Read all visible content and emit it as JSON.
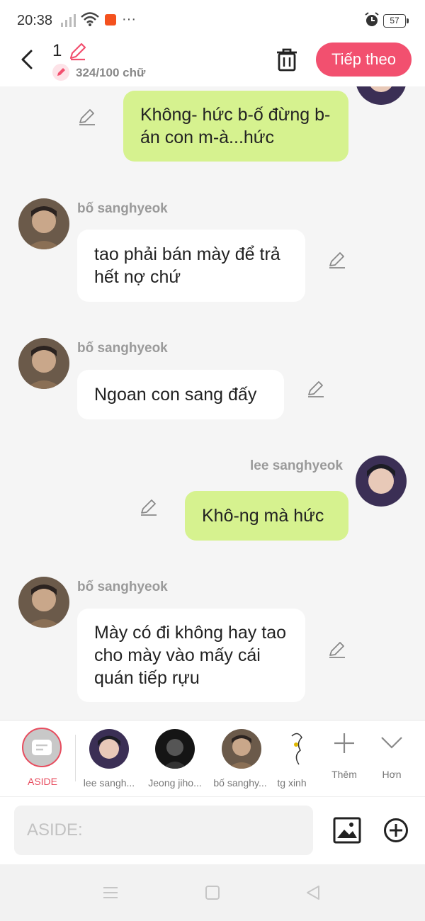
{
  "status_bar": {
    "time": "20:38",
    "battery": "57"
  },
  "header": {
    "episode_number": "1",
    "word_count": "324/100 chữ",
    "next_label": "Tiếp theo"
  },
  "messages": [
    {
      "side": "right",
      "text": "Không- hức b-ố đừng b-án con m-à...hức"
    },
    {
      "side": "left",
      "name": "bố sanghyeok",
      "text": "tao phải bán mày để trả hết nợ chứ"
    },
    {
      "side": "left",
      "name": "bố sanghyeok",
      "text": "Ngoan con sang đấy"
    },
    {
      "side": "right",
      "name": "lee sanghyeok",
      "text": "Khô-ng mà hức"
    },
    {
      "side": "left",
      "name": "bố sanghyeok",
      "text": "Mày có đi không hay tao cho mày vào mấy cái quán tiếp rựu"
    }
  ],
  "characters": {
    "aside_label": "ASIDE",
    "items": [
      {
        "label": "lee sangh..."
      },
      {
        "label": "Jeong jiho..."
      },
      {
        "label": "bố sanghy..."
      },
      {
        "label": "tg xinh"
      }
    ],
    "add_label": "Thêm",
    "more_label": "Hơn"
  },
  "input": {
    "placeholder": "ASIDE:"
  },
  "colors": {
    "accent": "#f2506f",
    "bubble_right": "#d6f28f",
    "bubble_left": "#ffffff",
    "background": "#f5f5f5"
  }
}
